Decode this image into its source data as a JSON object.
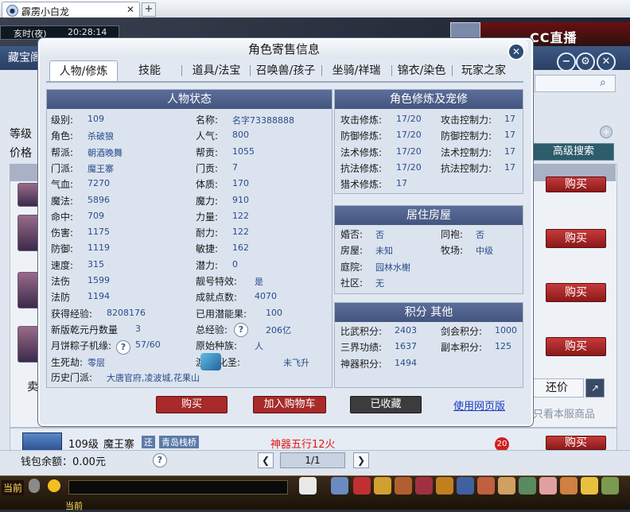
{
  "browser": {
    "tab_title": "霹雳小白龙",
    "tab_close": "✕",
    "new_tab": "+"
  },
  "game": {
    "time_label": "亥时(夜)",
    "time_value": "20:28:14",
    "stream_logo": "CC直播",
    "market_title": "藏宝阁",
    "level_label": "等级",
    "price_label": "价格",
    "advanced_search": "高级搜索",
    "buy": "购买",
    "sell_partial": "卖",
    "huanjia": "还价",
    "only_this_server": "只看本服商品",
    "row4": {
      "level": "109级",
      "school": "魔王寨",
      "tag1": "还",
      "tag2": "青岛栈桥",
      "weapon": "神器五行12火",
      "count": "20",
      "buy": "购买"
    },
    "wallet_label": "钱包余额：0.00元",
    "page": "1/1",
    "now_label": "当前",
    "now_label2": "当前"
  },
  "dialog": {
    "title": "角色寄售信息",
    "close": "✕",
    "tabs": [
      "人物/修炼",
      "技能",
      "道具/法宝",
      "召唤兽/孩子",
      "坐骑/祥瑞",
      "锦衣/染色",
      "玩家之家"
    ],
    "status_panel": {
      "title": "人物状态",
      "left": [
        {
          "label": "级别:",
          "value": "109"
        },
        {
          "label": "角色:",
          "value": "杀破狼"
        },
        {
          "label": "帮派:",
          "value": "朝酒晚舞"
        },
        {
          "label": "门派:",
          "value": "魔王寨"
        },
        {
          "label": "气血:",
          "value": "7270"
        },
        {
          "label": "魔法:",
          "value": "5896"
        },
        {
          "label": "命中:",
          "value": "709"
        },
        {
          "label": "伤害:",
          "value": "1175"
        },
        {
          "label": "防御:",
          "value": "1119"
        },
        {
          "label": "速度:",
          "value": "315"
        },
        {
          "label": "法伤",
          "value": "1599"
        },
        {
          "label": "法防",
          "value": "1194"
        },
        {
          "label": "获得经验:",
          "value": "8208176"
        },
        {
          "label": "新版乾元丹数量",
          "value": "3"
        },
        {
          "label": "月饼粽子机缘:",
          "value": "57/60"
        },
        {
          "label": "生死劫:",
          "value": "零层"
        }
      ],
      "right": [
        {
          "label": "名称:",
          "value": "名字73388888"
        },
        {
          "label": "人气:",
          "value": "800"
        },
        {
          "label": "帮贡:",
          "value": "1055"
        },
        {
          "label": "门贡:",
          "value": "7"
        },
        {
          "label": "体质:",
          "value": "170"
        },
        {
          "label": "魔力:",
          "value": "910"
        },
        {
          "label": "力量:",
          "value": "122"
        },
        {
          "label": "耐力:",
          "value": "122"
        },
        {
          "label": "敏捷:",
          "value": "162"
        },
        {
          "label": "潜力:",
          "value": "0"
        },
        {
          "label": "靓号特效:",
          "value": "是"
        },
        {
          "label": "成就点数:",
          "value": "4070"
        },
        {
          "label": "已用潜能果:",
          "value": "100"
        },
        {
          "label": "总经验:",
          "value": "206亿"
        },
        {
          "label": "原始种族:",
          "value": "人"
        },
        {
          "label": "渡劫/化圣:",
          "value": "未飞升"
        }
      ],
      "history_label": "历史门派:",
      "history_value": "大唐官府,凌波城,花果山",
      "help": "?"
    },
    "cultivation_panel": {
      "title": "角色修炼及宠修",
      "left": [
        {
          "label": "攻击修炼:",
          "value": "17/20"
        },
        {
          "label": "防御修炼:",
          "value": "17/20"
        },
        {
          "label": "法术修炼:",
          "value": "17/20"
        },
        {
          "label": "抗法修炼:",
          "value": "17/20"
        },
        {
          "label": "猎术修炼:",
          "value": "17"
        }
      ],
      "right": [
        {
          "label": "攻击控制力:",
          "value": "17"
        },
        {
          "label": "防御控制力:",
          "value": "17"
        },
        {
          "label": "法术控制力:",
          "value": "17"
        },
        {
          "label": "抗法控制力:",
          "value": "17"
        }
      ]
    },
    "house_panel": {
      "title": "居住房屋",
      "left": [
        {
          "label": "婚否:",
          "value": "否"
        },
        {
          "label": "房屋:",
          "value": "未知"
        },
        {
          "label": "庭院:",
          "value": "园林水榭"
        },
        {
          "label": "社区:",
          "value": "无"
        }
      ],
      "right": [
        {
          "label": "同袍:",
          "value": "否"
        },
        {
          "label": "牧场:",
          "value": "中级"
        }
      ]
    },
    "score_panel": {
      "title": "积分 其他",
      "left": [
        {
          "label": "比武积分:",
          "value": "2403"
        },
        {
          "label": "三界功绩:",
          "value": "1637"
        },
        {
          "label": "神器积分:",
          "value": "1494"
        }
      ],
      "right": [
        {
          "label": "剑会积分:",
          "value": "1000"
        },
        {
          "label": "副本积分:",
          "value": "125"
        }
      ]
    },
    "buttons": {
      "buy": "购买",
      "add_cart": "加入购物车",
      "favorited": "已收藏",
      "web_version": "使用网页版"
    }
  },
  "colors": {
    "buy_red": "#a82a2a",
    "cart_red": "#a82a2a",
    "favorited_gray": "#3c3c3c",
    "panel_header": "#4e6190",
    "value_blue": "#2a4c8c"
  }
}
